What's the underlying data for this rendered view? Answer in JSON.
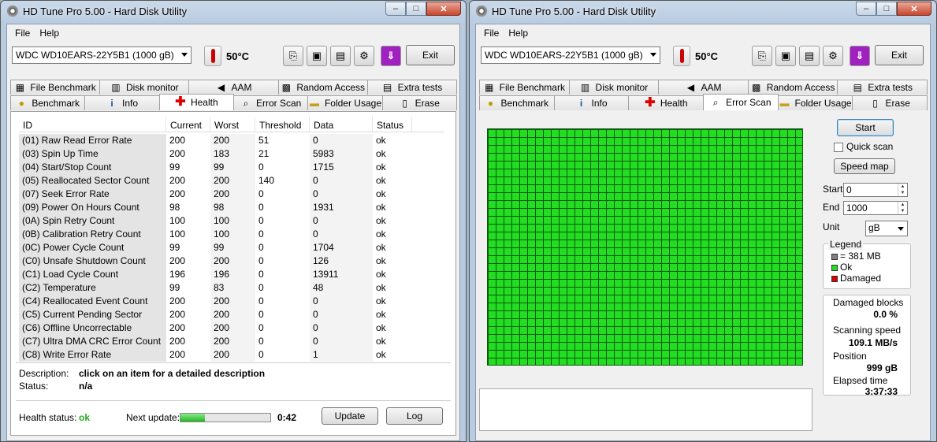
{
  "left_window": {
    "title": "HD Tune Pro 5.00 - Hard Disk Utility",
    "menu": [
      "File",
      "Help"
    ],
    "drive": "WDC WD10EARS-22Y5B1 (1000 gB)",
    "temperature": "50°C",
    "exit_label": "Exit",
    "tabs_row1": [
      "File Benchmark",
      "Disk monitor",
      "AAM",
      "Random Access",
      "Extra tests"
    ],
    "tabs_row2": [
      "Benchmark",
      "Info",
      "Health",
      "Error Scan",
      "Folder Usage",
      "Erase"
    ],
    "active_tab": "Health",
    "table": {
      "headers": [
        "ID",
        "Current",
        "Worst",
        "Threshold",
        "Data",
        "Status"
      ],
      "rows": [
        [
          "(01) Raw Read Error Rate",
          "200",
          "200",
          "51",
          "0",
          "ok"
        ],
        [
          "(03) Spin Up Time",
          "200",
          "183",
          "21",
          "5983",
          "ok"
        ],
        [
          "(04) Start/Stop Count",
          "99",
          "99",
          "0",
          "1715",
          "ok"
        ],
        [
          "(05) Reallocated Sector Count",
          "200",
          "200",
          "140",
          "0",
          "ok"
        ],
        [
          "(07) Seek Error Rate",
          "200",
          "200",
          "0",
          "0",
          "ok"
        ],
        [
          "(09) Power On Hours Count",
          "98",
          "98",
          "0",
          "1931",
          "ok"
        ],
        [
          "(0A) Spin Retry Count",
          "100",
          "100",
          "0",
          "0",
          "ok"
        ],
        [
          "(0B) Calibration Retry Count",
          "100",
          "100",
          "0",
          "0",
          "ok"
        ],
        [
          "(0C) Power Cycle Count",
          "99",
          "99",
          "0",
          "1704",
          "ok"
        ],
        [
          "(C0) Unsafe Shutdown Count",
          "200",
          "200",
          "0",
          "126",
          "ok"
        ],
        [
          "(C1) Load Cycle Count",
          "196",
          "196",
          "0",
          "13911",
          "ok"
        ],
        [
          "(C2) Temperature",
          "99",
          "83",
          "0",
          "48",
          "ok"
        ],
        [
          "(C4) Reallocated Event Count",
          "200",
          "200",
          "0",
          "0",
          "ok"
        ],
        [
          "(C5) Current Pending Sector",
          "200",
          "200",
          "0",
          "0",
          "ok"
        ],
        [
          "(C6) Offline Uncorrectable",
          "200",
          "200",
          "0",
          "0",
          "ok"
        ],
        [
          "(C7) Ultra DMA CRC Error Count",
          "200",
          "200",
          "0",
          "0",
          "ok"
        ],
        [
          "(C8) Write Error Rate",
          "200",
          "200",
          "0",
          "1",
          "ok"
        ]
      ]
    },
    "description_label": "Description:",
    "description_value": "click on an item for a detailed description",
    "status_label": "Status:",
    "status_value": "n/a",
    "health_status_label": "Health status:",
    "health_status_value": "ok",
    "next_update_label": "Next update:",
    "next_update_progress": 0.27,
    "next_update_time": "0:42",
    "update_label": "Update",
    "log_label": "Log"
  },
  "right_window": {
    "title": "HD Tune Pro 5.00 - Hard Disk Utility",
    "menu": [
      "File",
      "Help"
    ],
    "drive": "WDC WD10EARS-22Y5B1 (1000 gB)",
    "temperature": "50°C",
    "exit_label": "Exit",
    "tabs_row1": [
      "File Benchmark",
      "Disk monitor",
      "AAM",
      "Random Access",
      "Extra tests"
    ],
    "tabs_row2": [
      "Benchmark",
      "Info",
      "Health",
      "Error Scan",
      "Folder Usage",
      "Erase"
    ],
    "active_tab": "Error Scan",
    "start_label": "Start",
    "quick_scan_label": "Quick scan",
    "quick_scan_checked": false,
    "speed_map_label": "Speed map",
    "start_field_label": "Start",
    "start_value": "0",
    "end_field_label": "End",
    "end_value": "1000",
    "unit_label": "Unit",
    "unit_value": "gB",
    "legend_title": "Legend",
    "legend_items": [
      {
        "label": "= 381 MB",
        "color": "#808080"
      },
      {
        "label": "Ok",
        "color": "#22dd22"
      },
      {
        "label": "Damaged",
        "color": "#dd0000"
      }
    ],
    "damaged_blocks_label": "Damaged blocks",
    "damaged_blocks_value": "0.0 %",
    "scanning_speed_label": "Scanning speed",
    "scanning_speed_value": "109.1 MB/s",
    "position_label": "Position",
    "position_value": "999 gB",
    "elapsed_label": "Elapsed time",
    "elapsed_value": "3:37:33"
  },
  "colors": {
    "ok_green": "#22dd22",
    "health_ok_text": "#22aa22",
    "damaged_red": "#dd0000"
  },
  "icons": {
    "File Benchmark": "file-benchmark-icon",
    "Disk monitor": "disk-monitor-icon",
    "AAM": "speaker-icon",
    "Random Access": "random-access-icon",
    "Extra tests": "extra-tests-icon",
    "Benchmark": "lightbulb-icon",
    "Info": "info-icon",
    "Health": "red-cross-icon",
    "Error Scan": "magnifier-icon",
    "Folder Usage": "folder-icon",
    "Erase": "trash-icon"
  }
}
